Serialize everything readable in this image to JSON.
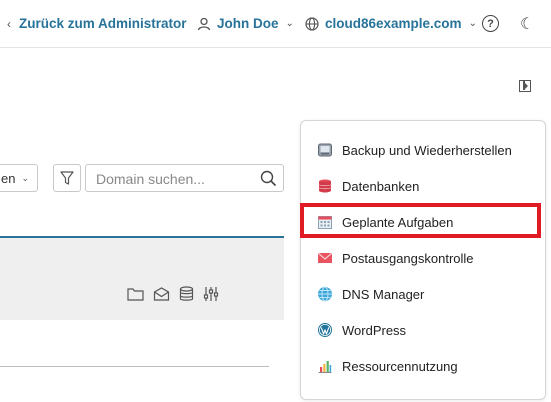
{
  "topbar": {
    "back_label": "Zurück zum Administrator",
    "user_name": "John Doe",
    "domain_name": "cloud86example.com",
    "help_label": "?"
  },
  "filter": {
    "select_value": "en"
  },
  "search": {
    "placeholder": "Domain suchen..."
  },
  "menu": {
    "items": [
      {
        "label": "Backup und Wiederherstellen",
        "icon": "backup-icon"
      },
      {
        "label": "Datenbanken",
        "icon": "database-icon"
      },
      {
        "label": "Geplante Aufgaben",
        "icon": "calendar-icon",
        "highlighted": true
      },
      {
        "label": "Postausgangskontrolle",
        "icon": "mail-icon"
      },
      {
        "label": "DNS Manager",
        "icon": "globe-icon"
      },
      {
        "label": "WordPress",
        "icon": "wordpress-icon"
      },
      {
        "label": "Ressourcennutzung",
        "icon": "bar-chart-icon"
      }
    ]
  },
  "colors": {
    "accent": "#28739a",
    "highlight": "#e01b24"
  }
}
